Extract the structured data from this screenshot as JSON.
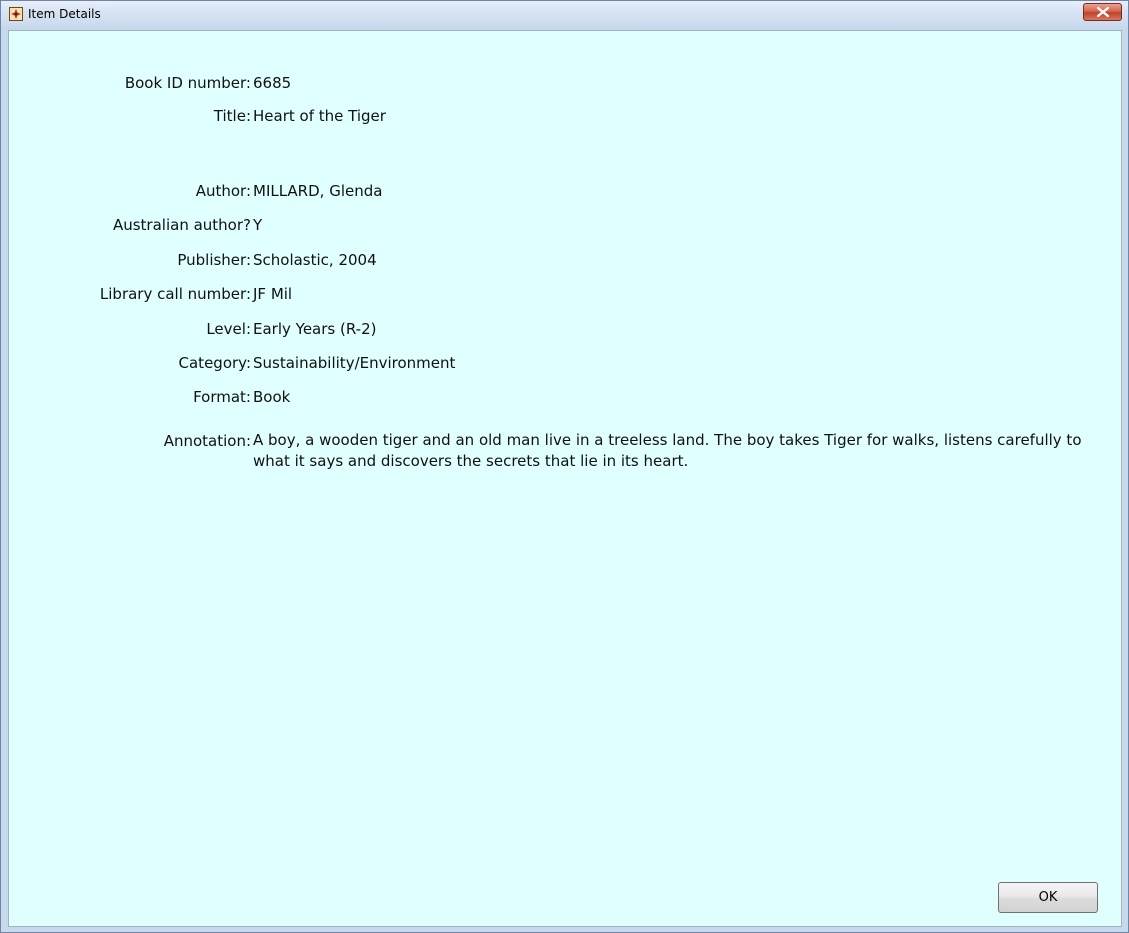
{
  "window": {
    "title": "Item Details",
    "app_icon": "app-icon",
    "close_icon": "close-icon",
    "client_background": "#e0ffff",
    "close_color": "#c8462b"
  },
  "fields": {
    "book_id": {
      "label": "Book ID number:",
      "value": "6685"
    },
    "title": {
      "label": "Title:",
      "value": "Heart of the Tiger"
    },
    "author": {
      "label": "Author:",
      "value": "MILLARD, Glenda"
    },
    "australian_author": {
      "label": "Australian author?",
      "value": "Y"
    },
    "publisher": {
      "label": "Publisher:",
      "value": "Scholastic, 2004"
    },
    "call_number": {
      "label": "Library call number:",
      "value": "JF Mil"
    },
    "level": {
      "label": "Level:",
      "value": "Early Years (R-2)"
    },
    "category": {
      "label": "Category:",
      "value": "Sustainability/Environment"
    },
    "format": {
      "label": "Format:",
      "value": "Book"
    },
    "annotation": {
      "label": "Annotation:",
      "value": "A boy, a wooden tiger and an old man live in a treeless land. The boy takes Tiger for walks, listens carefully to what it says and discovers the secrets that lie in its heart."
    }
  },
  "buttons": {
    "ok_label": "OK"
  }
}
